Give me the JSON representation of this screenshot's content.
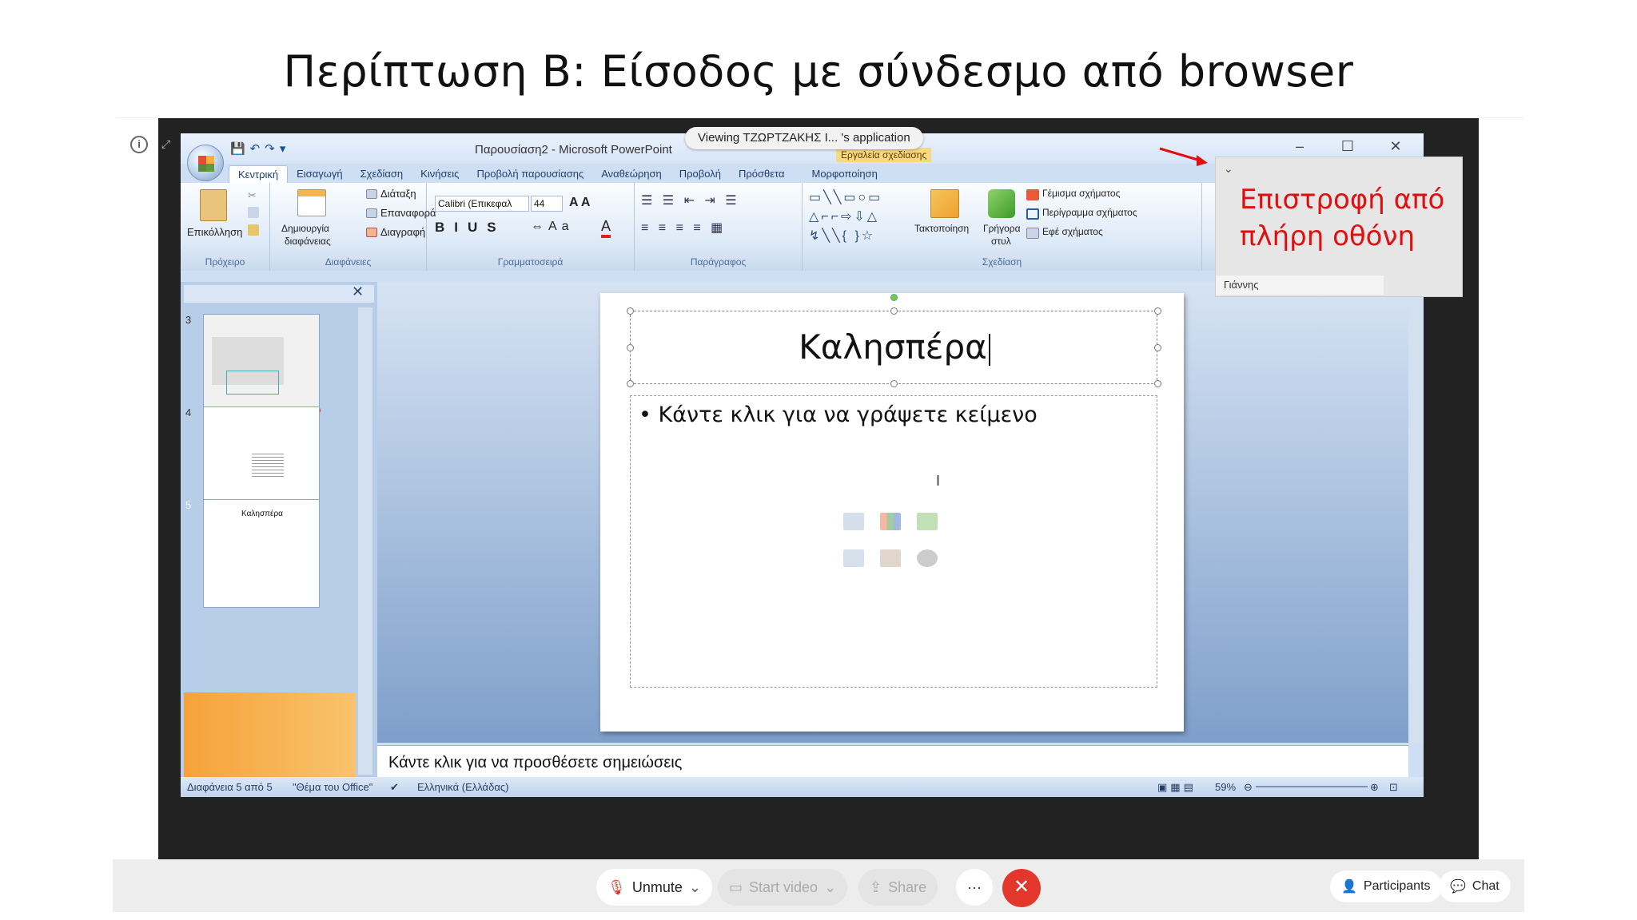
{
  "page_title": "Περίπτωση Β: Είσοδος με σύνδεσμο από browser",
  "viewing_banner": "Viewing ΤΖΩΡΤΖΑΚΗΣ Ι...  's application",
  "popup": {
    "line1": "Επιστροφή από",
    "line2": "πλήρη οθόνη",
    "name": "Γιάννης"
  },
  "ppt": {
    "window_title": "Παρουσίαση2 - Microsoft PowerPoint",
    "context_tab_label": "Εργαλεία σχεδίασης",
    "tabs": [
      "Κεντρική",
      "Εισαγωγή",
      "Σχεδίαση",
      "Κινήσεις",
      "Προβολή παρουσίασης",
      "Αναθεώρηση",
      "Προβολή",
      "Πρόσθετα",
      "Μορφοποίηση"
    ],
    "groups": {
      "clipboard": {
        "label": "Πρόχειρο",
        "paste": "Επικόλληση"
      },
      "slides": {
        "label": "Διαφάνειες",
        "new_slide_1": "Δημιουργία",
        "new_slide_2": "διαφάνειας",
        "layout": "Διάταξη",
        "reset": "Επαναφορά",
        "delete": "Διαγραφή"
      },
      "font": {
        "label": "Γραμματοσειρά",
        "font_name": "Calibri (Επικεφαλ",
        "font_size": "44"
      },
      "paragraph": {
        "label": "Παράγραφος"
      },
      "drawing": {
        "label": "Σχεδίαση",
        "arrange": "Τακτοποίηση",
        "quick_styles_1": "Γρήγορα",
        "quick_styles_2": "στυλ",
        "fill": "Γέμισμα σχήματος",
        "outline": "Περίγραμμα σχήματος",
        "effects": "Εφέ σχήματος"
      }
    },
    "thumbnails": [
      {
        "num": "3",
        "title": ""
      },
      {
        "num": "4",
        "title": ""
      },
      {
        "num": "5",
        "title": "Καλησπέρα"
      }
    ],
    "slide_title": "Καλησπέρα",
    "slide_bullet": "Κάντε κλικ για να γράψετε κείμενο",
    "notes_placeholder": "Κάντε κλικ για να προσθέσετε σημειώσεις",
    "status": {
      "slide": "Διαφάνεια 5 από 5",
      "theme": "\"Θέμα του Office\"",
      "language": "Ελληνικά (Ελλάδας)",
      "zoom": "59%"
    }
  },
  "meeting": {
    "unmute": "Unmute",
    "start_video": "Start video",
    "share": "Share",
    "more": "···",
    "participants": "Participants",
    "chat": "Chat"
  },
  "colors": {
    "popup_text": "#e01010",
    "end_call": "#e2372a",
    "selected_thumb": "#f6a23a"
  }
}
